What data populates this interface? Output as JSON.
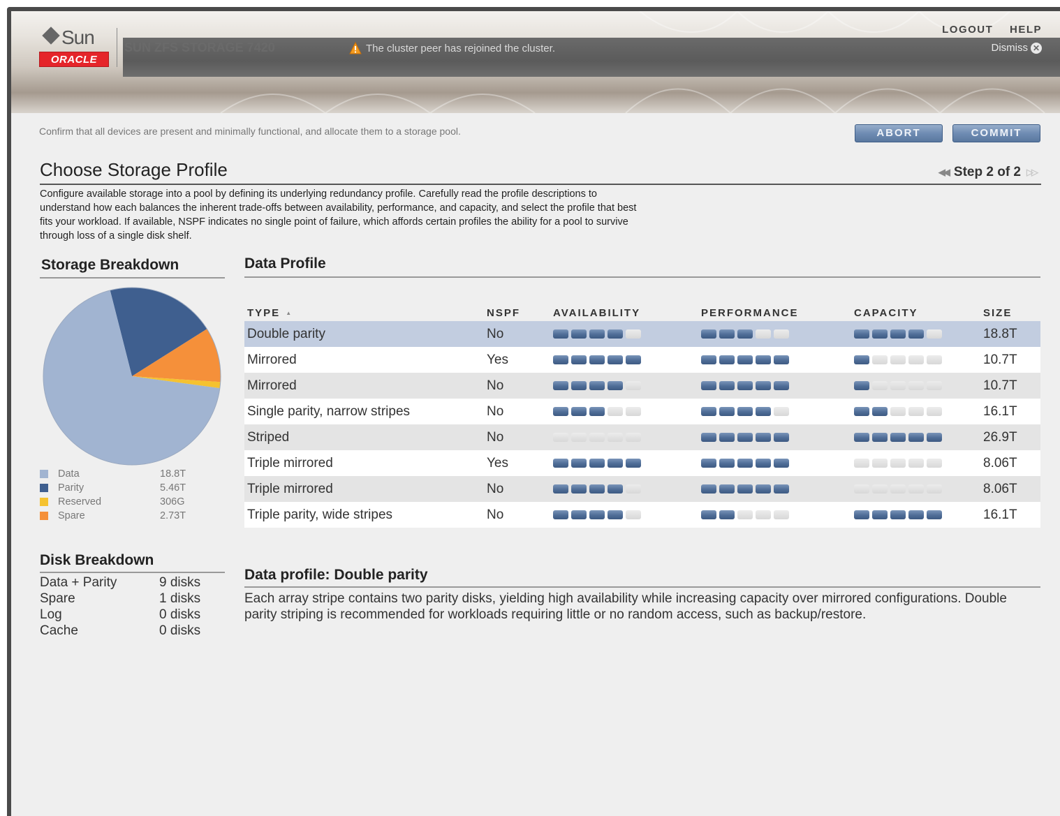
{
  "header": {
    "logo_sun": "Sun",
    "logo_oracle": "ORACLE",
    "product": "SUN ZFS STORAGE 7420",
    "alert_icon": "warning-icon",
    "alert": "The cluster peer has rejoined the cluster.",
    "logout": "LOGOUT",
    "help": "HELP",
    "dismiss": "Dismiss",
    "dismiss_icon": "close-icon"
  },
  "toolbar": {
    "instruction": "Confirm that all devices are present and minimally functional, and allocate them to a storage pool.",
    "abort": "ABORT",
    "commit": "COMMIT"
  },
  "page": {
    "title": "Choose Storage Profile",
    "step": "Step 2 of 2",
    "intro": "Configure available storage into a pool by defining its underlying redundancy profile. Carefully read the profile descriptions to understand how each balances the inherent trade-offs between availability, performance, and capacity, and select the profile that best fits your workload. If available, NSPF indicates no single point of failure, which affords certain profiles the ability for a pool to survive through loss of a single disk shelf."
  },
  "storage_breakdown": {
    "title": "Storage Breakdown",
    "items": [
      {
        "label": "Data",
        "value": "18.8T",
        "color": "#a1b4d1"
      },
      {
        "label": "Parity",
        "value": "5.46T",
        "color": "#3f5f8f"
      },
      {
        "label": "Reserved",
        "value": "306G",
        "color": "#f5c230"
      },
      {
        "label": "Spare",
        "value": "2.73T",
        "color": "#f5903a"
      }
    ]
  },
  "chart_data": {
    "type": "pie",
    "categories": [
      "Data",
      "Parity",
      "Reserved",
      "Spare"
    ],
    "values": [
      18.8,
      5.46,
      0.306,
      2.73
    ],
    "units": [
      "T",
      "T",
      "G",
      "T"
    ],
    "colors": [
      "#a1b4d1",
      "#3f5f8f",
      "#f5c230",
      "#f5903a"
    ]
  },
  "disk_breakdown": {
    "title": "Disk Breakdown",
    "rows": [
      {
        "label": "Data + Parity",
        "value": "9 disks"
      },
      {
        "label": "Spare",
        "value": "1 disks"
      },
      {
        "label": "Log",
        "value": "0 disks"
      },
      {
        "label": "Cache",
        "value": "0 disks"
      }
    ]
  },
  "data_profile": {
    "title": "Data Profile",
    "columns": [
      "TYPE",
      "NSPF",
      "AVAILABILITY",
      "PERFORMANCE",
      "CAPACITY",
      "SIZE"
    ],
    "sort_icon": "sort-ascending-icon",
    "selected_row": 0,
    "rows": [
      {
        "type": "Double parity",
        "nspf": "No",
        "availability": 4,
        "performance": 3,
        "capacity": 4,
        "size": "18.8T"
      },
      {
        "type": "Mirrored",
        "nspf": "Yes",
        "availability": 5,
        "performance": 5,
        "capacity": 1,
        "size": "10.7T"
      },
      {
        "type": "Mirrored",
        "nspf": "No",
        "availability": 4,
        "performance": 5,
        "capacity": 1,
        "size": "10.7T"
      },
      {
        "type": "Single parity, narrow stripes",
        "nspf": "No",
        "availability": 3,
        "performance": 4,
        "capacity": 2,
        "size": "16.1T"
      },
      {
        "type": "Striped",
        "nspf": "No",
        "availability": 0,
        "performance": 5,
        "capacity": 5,
        "size": "26.9T"
      },
      {
        "type": "Triple mirrored",
        "nspf": "Yes",
        "availability": 5,
        "performance": 5,
        "capacity": 0,
        "size": "8.06T"
      },
      {
        "type": "Triple mirrored",
        "nspf": "No",
        "availability": 4,
        "performance": 5,
        "capacity": 0,
        "size": "8.06T"
      },
      {
        "type": "Triple parity, wide stripes",
        "nspf": "No",
        "availability": 4,
        "performance": 2,
        "capacity": 5,
        "size": "16.1T"
      }
    ]
  },
  "description": {
    "title": "Data profile: Double parity",
    "text": "Each array stripe contains two parity disks, yielding high availability while increasing capacity over mirrored configurations. Double parity striping is recommended for workloads requiring little or no random access, such as backup/restore."
  }
}
